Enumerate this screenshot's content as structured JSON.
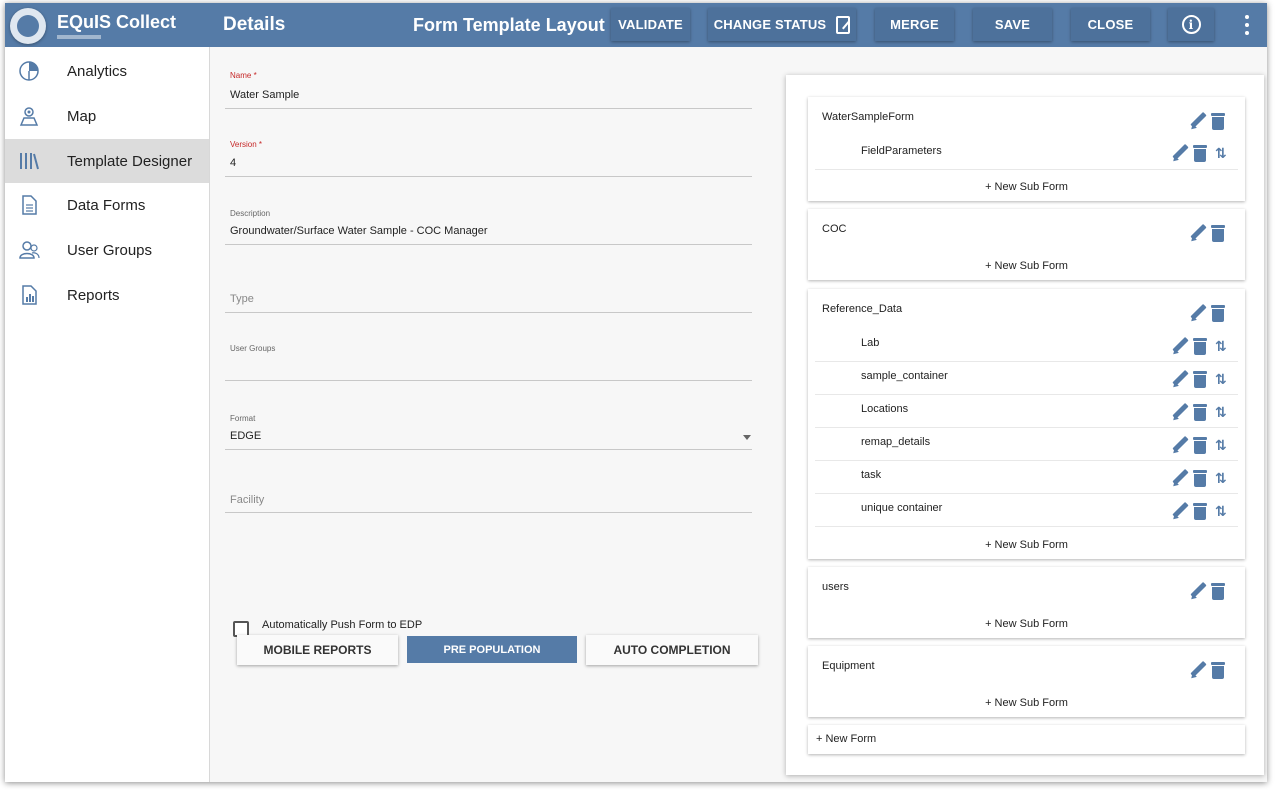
{
  "app": {
    "name": "EQuIS Collect",
    "page_title": "Details",
    "layout_title": "Form Template Layout"
  },
  "toolbar": {
    "validate": "VALIDATE",
    "change_status": "CHANGE STATUS",
    "merge": "MERGE",
    "save": "SAVE",
    "close": "CLOSE",
    "info": "i"
  },
  "sidebar": {
    "items": [
      {
        "label": "Analytics",
        "icon": "pie-chart-icon"
      },
      {
        "label": "Map",
        "icon": "map-pin-icon"
      },
      {
        "label": "Template Designer",
        "icon": "library-icon",
        "active": true
      },
      {
        "label": "Data Forms",
        "icon": "document-icon"
      },
      {
        "label": "User Groups",
        "icon": "users-icon"
      },
      {
        "label": "Reports",
        "icon": "report-icon"
      }
    ]
  },
  "form": {
    "name": {
      "label": "Name *",
      "value": "Water Sample"
    },
    "version": {
      "label": "Version *",
      "value": "4"
    },
    "description": {
      "label": "Description",
      "value": "Groundwater/Surface Water Sample - COC Manager"
    },
    "type": {
      "placeholder": "Type"
    },
    "user_groups": {
      "label": "User Groups"
    },
    "format": {
      "label": "Format",
      "value": "EDGE"
    },
    "facility": {
      "placeholder": "Facility"
    },
    "auto_push": {
      "label": "Automatically Push Form to EDP",
      "checked": false
    },
    "buttons": {
      "mobile_reports": "MOBILE REPORTS",
      "pre_population": "PRE POPULATION",
      "auto_completion": "AUTO COMPLETION"
    }
  },
  "layout": {
    "new_sub_form": "+ New Sub Form",
    "new_form": "+ New Form",
    "forms": [
      {
        "name": "WaterSampleForm",
        "sub_forms": [
          "FieldParameters"
        ]
      },
      {
        "name": "COC",
        "sub_forms": []
      },
      {
        "name": "Reference_Data",
        "sub_forms": [
          "Lab",
          "sample_container",
          "Locations",
          "remap_details",
          "task",
          "unique container"
        ]
      },
      {
        "name": "users",
        "sub_forms": []
      },
      {
        "name": "Equipment",
        "sub_forms": []
      }
    ]
  },
  "colors": {
    "primary": "#557ba7",
    "required": "#c62828",
    "active_nav": "#dcdcdc"
  }
}
